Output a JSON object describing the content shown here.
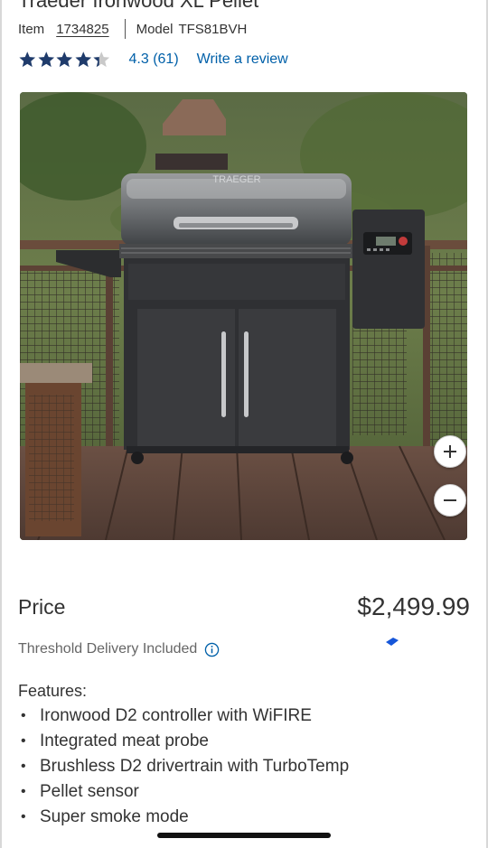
{
  "product": {
    "title": "Traeger Ironwood XL Pellet Grill",
    "item_label": "Item",
    "item_number": "1734825",
    "model_label": "Model",
    "model_number": "TFS81BVH"
  },
  "rating": {
    "stars": 4.3,
    "value_text": "4.3",
    "count_text": "(61)",
    "write_review": "Write a review"
  },
  "image": {
    "alt": "Traeger pellet grill on wooden deck",
    "brand_mark": "TRAEGER",
    "zoom_in_icon": "plus-icon",
    "zoom_out_icon": "minus-icon"
  },
  "pricing": {
    "label": "Price",
    "value": "$2,499.99"
  },
  "delivery": {
    "text": "Threshold Delivery Included",
    "icon": "info-icon"
  },
  "features": {
    "title": "Features:",
    "items": [
      "Ironwood D2 controller with WiFIRE",
      "Integrated meat probe",
      "Brushless D2 drivertrain with TurboTemp",
      "Pellet sensor",
      "Super smoke mode"
    ]
  },
  "colors": {
    "link": "#0060a9",
    "star": "#1f3b6b",
    "text": "#333333",
    "muted": "#666666"
  }
}
